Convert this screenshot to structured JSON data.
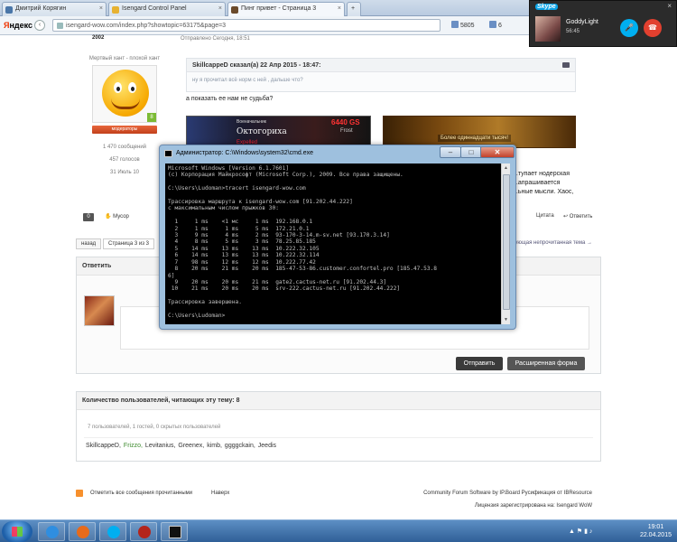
{
  "browser": {
    "tabs": [
      {
        "label": "Дмитрий Корягин",
        "color": "#4a76a8",
        "active": false
      },
      {
        "label": "Isengard Control Panel",
        "color": "#e7b232",
        "active": false
      },
      {
        "label": "Пинг привет - Страница 3",
        "color": "#6b4a2a",
        "active": true
      }
    ],
    "logo_pre": "Я",
    "logo_rest": "ндекс",
    "url": "isengard-wow.com/index.php?showtopic=63175&page=3",
    "count_mail": "5805",
    "count_likes": "6"
  },
  "post": {
    "score": "2002",
    "sent": "Отправлено Сегодня, 18:51",
    "author": {
      "rank_title": "Мертвый хант - плохой хант",
      "rep": "8",
      "group": "модераторы",
      "messages": "1 470 сообщений",
      "votes": "457 голосов",
      "location": "31 Июль 10"
    },
    "quote_header": "SkillcappeD сказал(а) 22 Апр 2015 - 18:47:",
    "quote_body": "ну я прочитал всё норм с ней , дальше что?",
    "reply_text": "а показать ее нам не судьба?",
    "sig": {
      "guild_rank": "Военачальник",
      "char_name": "Октогориха",
      "gs": "6440 GS",
      "realm": "Frost",
      "status": "Expelled",
      "banner": "Более одиннадцати тысяч!"
    },
    "body_right": [
      "...тупает нодерская",
      "...апрашивается",
      "...ьные мысли. Хаос,"
    ],
    "vote": "0",
    "trash": "Мусор",
    "quote_btn": "Цитата",
    "answer_btn": "Ответить"
  },
  "pager": {
    "back": "назад",
    "page": "Страница 3 из 3",
    "next": "Следующая непрочитанная тема →"
  },
  "reply": {
    "title": "Ответить",
    "send": "Отправить",
    "advanced": "Расширенная форма"
  },
  "viewers": {
    "title": "Количество пользователей, читающих эту тему: 8",
    "stats": "7 пользователей, 1 гостей, 0 скрытых пользователей",
    "users": [
      {
        "name": "SkillcappeD,",
        "color": "#333333"
      },
      {
        "name": "Frizzo,",
        "color": "#3b8a2c"
      },
      {
        "name": "Levitanius,",
        "color": "#333333"
      },
      {
        "name": "Greenex,",
        "color": "#333333"
      },
      {
        "name": "kimb,",
        "color": "#333333"
      },
      {
        "name": "ggggckain,",
        "color": "#333333"
      },
      {
        "name": "Jeedis",
        "color": "#333333"
      }
    ]
  },
  "footer": {
    "mark_read": "Отметить все сообщения прочитанными",
    "top": "Наверх",
    "software": "Community Forum Software by IP.Board Русификация от IBResource",
    "license": "Лицензия зарегистрирована на: Isengard WoW"
  },
  "cmd": {
    "title": "Администратор: C:\\Windows\\system32\\cmd.exe",
    "lines": [
      "Microsoft Windows [Version 6.1.7601]",
      "(c) Корпорация Майкрософт (Microsoft Corp.), 2009. Все права защищены.",
      "",
      "C:\\Users\\Ludoman>tracert isengard-wow.com",
      "",
      "Трассировка маршрута к isengard-wow.com [91.202.44.222]",
      "с максимальным числом прыжков 30:",
      "",
      "  1     1 ms    <1 мс     1 ms  192.168.0.1",
      "  2     1 ms     1 ms     5 ms  172.21.0.1",
      "  3     9 ms     4 ms     2 ms  93-170-3-14.m-sv.net [93.170.3.14]",
      "  4     8 ms     5 ms     3 ms  78.25.85.185",
      "  5    14 ms    13 ms    13 ms  10.222.32.105",
      "  6    14 ms    13 ms    13 ms  10.222.32.114",
      "  7    98 ms    12 ms    12 ms  10.222.77.42",
      "  8    20 ms    21 ms    20 ms  185-47-53-86.customer.confortel.pro [185.47.53.8",
      "6]",
      "  9    20 ms    20 ms    21 ms  gate2.cactus-net.ru [91.202.44.3]",
      " 10    21 ms    20 ms    20 ms  srv-222.cactus-net.ru [91.202.44.222]",
      "",
      "Трассировка завершена.",
      "",
      "C:\\Users\\Ludoman>"
    ]
  },
  "skype": {
    "logo": "Skype",
    "name": "GoddyLight",
    "time": "56:45"
  },
  "taskbar": {
    "time": "19:01",
    "date": "22.04.2015",
    "apps": [
      {
        "name": "ie",
        "color": "#2f8ee0"
      },
      {
        "name": "firefox",
        "color": "#e66b1c"
      },
      {
        "name": "skype",
        "color": "#00aff0"
      },
      {
        "name": "dota",
        "color": "#b3251d"
      },
      {
        "name": "cmd",
        "color": "#111111"
      }
    ]
  }
}
